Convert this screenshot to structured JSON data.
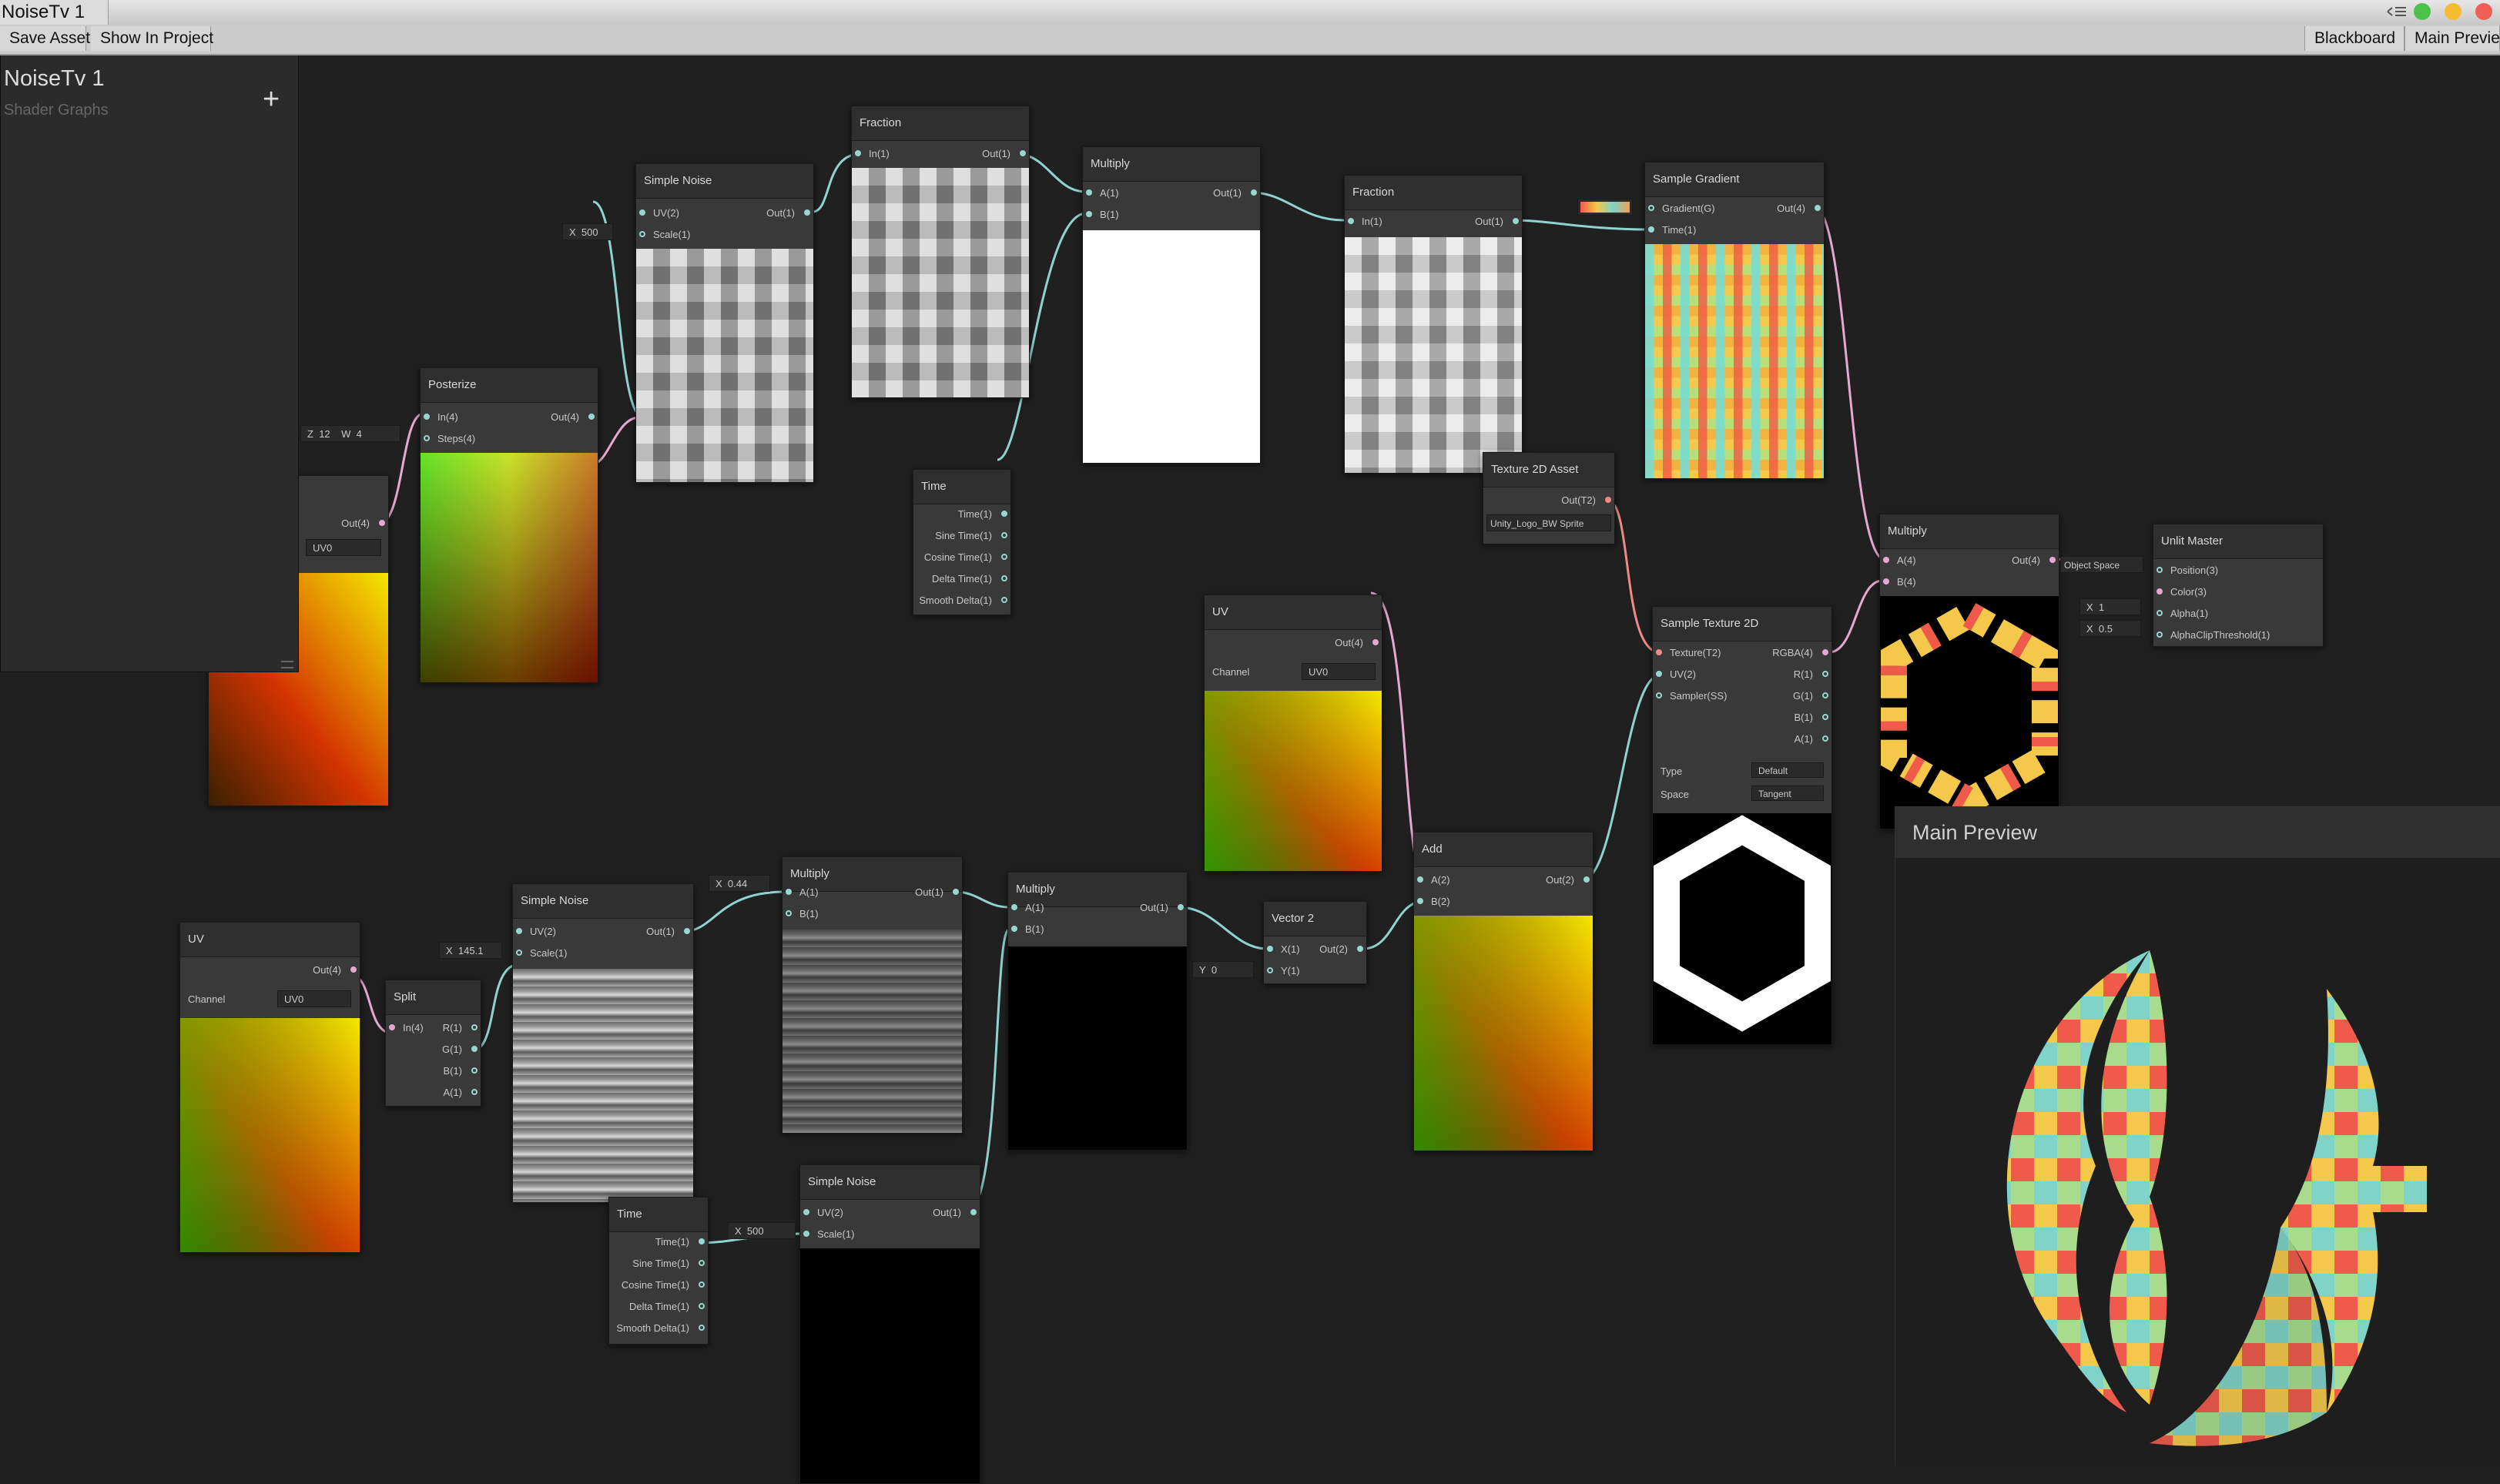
{
  "window": {
    "title": "NoiseTv 1"
  },
  "toolbar": {
    "save_asset": "Save Asset",
    "show_in_project": "Show In Project",
    "blackboard": "Blackboard",
    "main_preview": "Main Preview"
  },
  "blackboard": {
    "title": "NoiseTv 1",
    "subtitle": "Shader Graphs",
    "add_symbol": "+"
  },
  "nodes": {
    "simple_noise_1": {
      "title": "Simple Noise",
      "in1": "UV(2)",
      "in2": "Scale(1)",
      "out": "Out(1)",
      "scale_label": "X",
      "scale_value": "500"
    },
    "fraction_1": {
      "title": "Fraction",
      "in": "In(1)",
      "out": "Out(1)"
    },
    "multiply_1": {
      "title": "Multiply",
      "in1": "A(1)",
      "in2": "B(1)",
      "out": "Out(1)"
    },
    "fraction_2": {
      "title": "Fraction",
      "in": "In(1)",
      "out": "Out(1)"
    },
    "sample_gradient": {
      "title": "Sample Gradient",
      "in1": "Gradient(G)",
      "in2": "Time(1)",
      "out": "Out(4)"
    },
    "posterize": {
      "title": "Posterize",
      "in1": "In(4)",
      "in2": "Steps(4)",
      "out": "Out(4)",
      "z_label": "Z",
      "z_value": "12",
      "w_label": "W",
      "w_value": "4"
    },
    "uv_hidden": {
      "out": "Out(4)",
      "channel": "UV0"
    },
    "time_1": {
      "title": "Time",
      "outs": [
        "Time(1)",
        "Sine Time(1)",
        "Cosine Time(1)",
        "Delta Time(1)",
        "Smooth Delta(1)"
      ]
    },
    "texture_asset": {
      "title": "Texture 2D Asset",
      "out": "Out(T2)",
      "value": "Unity_Logo_BW Sprite"
    },
    "uv_mid": {
      "title": "UV",
      "out": "Out(4)",
      "channel_label": "Channel",
      "channel": "UV0"
    },
    "sample_texture": {
      "title": "Sample Texture 2D",
      "ins": [
        "Texture(T2)",
        "UV(2)",
        "Sampler(SS)"
      ],
      "outs": [
        "RGBA(4)",
        "R(1)",
        "G(1)",
        "B(1)",
        "A(1)"
      ],
      "type_label": "Type",
      "type_value": "Default",
      "space_label": "Space",
      "space_value": "Tangent"
    },
    "multiply_color": {
      "title": "Multiply",
      "in1": "A(4)",
      "in2": "B(4)",
      "out": "Out(4)"
    },
    "unlit_master": {
      "title": "Unlit Master",
      "ins": [
        "Position(3)",
        "Color(3)",
        "Alpha(1)",
        "AlphaClipThreshold(1)"
      ],
      "pos_value": "Object Space",
      "alpha_label": "X",
      "alpha_value": "1",
      "clip_label": "X",
      "clip_value": "0.5"
    },
    "uv_bottom": {
      "title": "UV",
      "out": "Out(4)",
      "channel_label": "Channel",
      "channel": "UV0"
    },
    "split": {
      "title": "Split",
      "in": "In(4)",
      "outs": [
        "R(1)",
        "G(1)",
        "B(1)",
        "A(1)"
      ]
    },
    "simple_noise_2": {
      "title": "Simple Noise",
      "in1": "UV(2)",
      "in2": "Scale(1)",
      "out": "Out(1)",
      "scale_label": "X",
      "scale_value": "145.1"
    },
    "multiply_2": {
      "title": "Multiply",
      "in1": "A(1)",
      "in2": "B(1)",
      "out": "Out(1)",
      "b_label": "X",
      "b_value": "0.44"
    },
    "multiply_3": {
      "title": "Multiply",
      "in1": "A(1)",
      "in2": "B(1)",
      "out": "Out(1)"
    },
    "vector2": {
      "title": "Vector 2",
      "in1": "X(1)",
      "in2": "Y(1)",
      "out": "Out(2)",
      "y_label": "Y",
      "y_value": "0"
    },
    "add": {
      "title": "Add",
      "in1": "A(2)",
      "in2": "B(2)",
      "out": "Out(2)"
    },
    "time_2": {
      "title": "Time",
      "outs": [
        "Time(1)",
        "Sine Time(1)",
        "Cosine Time(1)",
        "Delta Time(1)",
        "Smooth Delta(1)"
      ]
    },
    "simple_noise_3": {
      "title": "Simple Noise",
      "in1": "UV(2)",
      "in2": "Scale(1)",
      "out": "Out(1)",
      "scale_label": "X",
      "scale_value": "500"
    }
  },
  "main_preview_panel": {
    "title": "Main Preview"
  },
  "colors": {
    "wire_float": "#8fd3cf",
    "wire_vector": "#e6a8d0",
    "wire_texture": "#f08a8a",
    "background": "#202020"
  }
}
